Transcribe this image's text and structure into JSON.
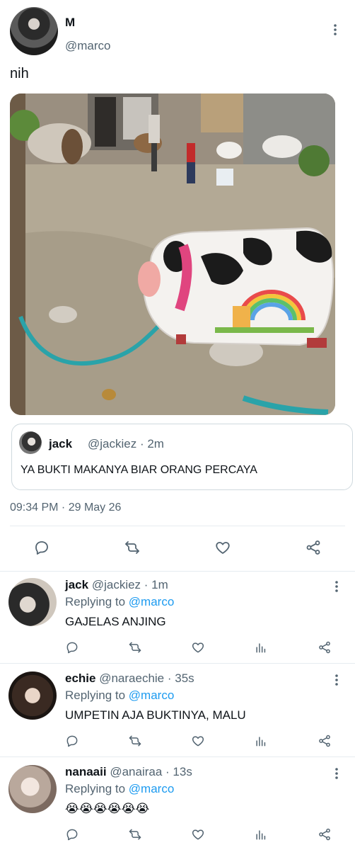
{
  "tweet": {
    "display_name": "M",
    "handle": "@marco",
    "text": "nih",
    "timestamp": "09:34 PM · 29 May 26",
    "quote": {
      "name": "jack",
      "meta": "@jackiez · 2m",
      "text": "YA BUKTI MAKANYA BIAR ORANG PERCAYA"
    }
  },
  "replies": [
    {
      "name": "jack",
      "meta": "@jackiez · 1m",
      "replying_prefix": "Replying to",
      "replying_to": "@marco",
      "text": "GAJELAS ANJING"
    },
    {
      "name": "echie",
      "meta": "@naraechie · 35s",
      "replying_prefix": "Replying to",
      "replying_to": "@marco",
      "text": "UMPETIN AJA BUKTINYA, MALU"
    },
    {
      "name": "nanaaii",
      "meta": "@anairaa · 13s",
      "replying_prefix": "Replying to",
      "replying_to": "@marco",
      "text": "😭😭😭😭😭😭"
    }
  ],
  "icons": [
    "more-icon",
    "reply-icon",
    "retweet-icon",
    "like-icon",
    "share-icon",
    "analytics-icon"
  ],
  "colors": {
    "accent": "#1d9bf0",
    "muted": "#536471",
    "divider": "#e6ecf0"
  }
}
